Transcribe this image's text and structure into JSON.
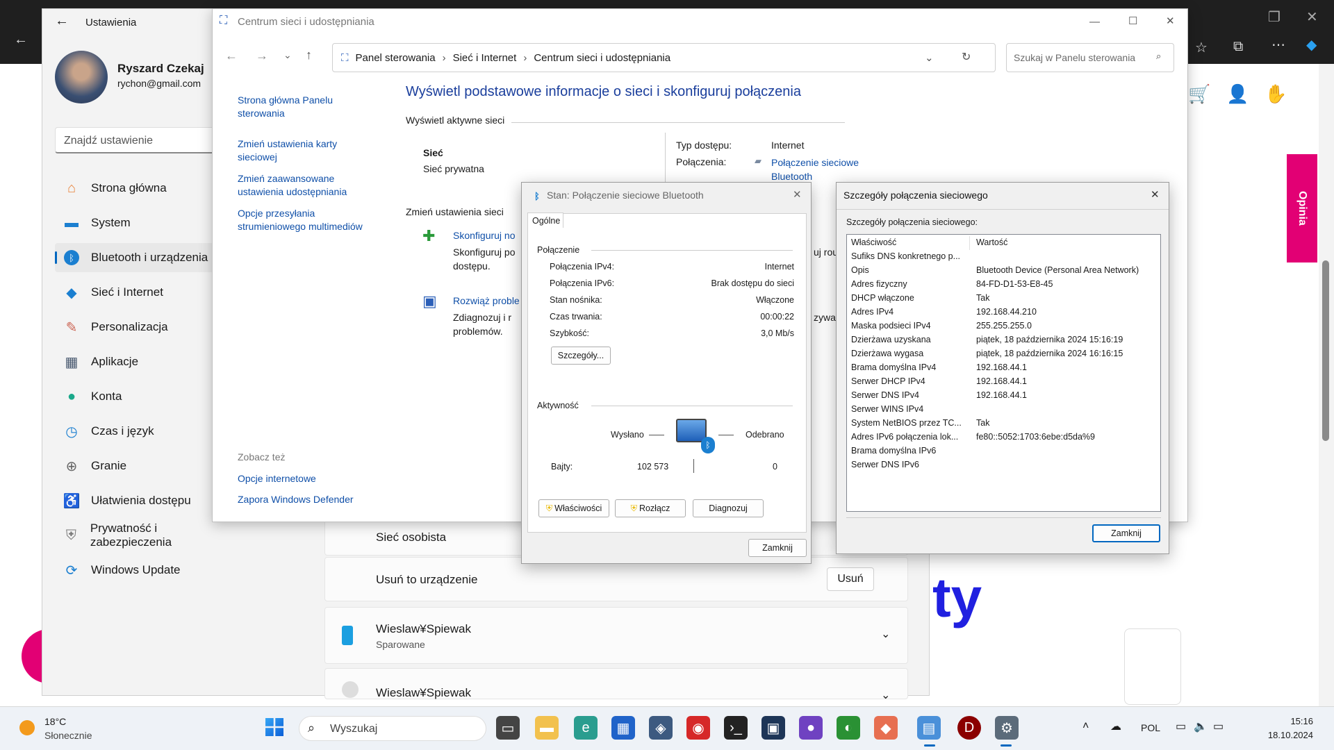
{
  "settings": {
    "title": "Ustawienia",
    "user_name": "Ryszard Czekaj",
    "user_email": "rychon@gmail.com",
    "search_placeholder": "Znajdź ustawienie",
    "nav": [
      {
        "label": "Strona główna",
        "icon": "home-icon"
      },
      {
        "label": "System",
        "icon": "monitor-icon"
      },
      {
        "label": "Bluetooth i urządzenia",
        "icon": "bluetooth-icon"
      },
      {
        "label": "Sieć i Internet",
        "icon": "wifi-icon"
      },
      {
        "label": "Personalizacja",
        "icon": "brush-icon"
      },
      {
        "label": "Aplikacje",
        "icon": "apps-icon"
      },
      {
        "label": "Konta",
        "icon": "person-icon"
      },
      {
        "label": "Czas i język",
        "icon": "clock-icon"
      },
      {
        "label": "Granie",
        "icon": "gamepad-icon"
      },
      {
        "label": "Ułatwienia dostępu",
        "icon": "accessibility-icon"
      },
      {
        "label": "Prywatność i zabezpieczenia",
        "icon": "shield-icon"
      },
      {
        "label": "Windows Update",
        "icon": "update-icon"
      }
    ],
    "personal_network": "Sieć osobista",
    "remove_device": "Usuń to urządzenie",
    "remove_button": "Usuń",
    "devices": [
      {
        "name": "Wieslaw¥Spiewak",
        "status": "Sparowane"
      },
      {
        "name": "Wieslaw¥Spiewak",
        "status": ""
      }
    ]
  },
  "background_page": {
    "opinia": "Opinia",
    "big_text": "ty"
  },
  "control_panel": {
    "title": "Centrum sieci i udostępniania",
    "breadcrumb": [
      "Panel sterowania",
      "Sieć i Internet",
      "Centrum sieci i udostępniania"
    ],
    "search_placeholder": "Szukaj w Panelu sterowania",
    "left_links": [
      "Strona główna Panelu sterowania",
      "Zmień ustawienia karty sieciowej",
      "Zmień zaawansowane ustawienia udostępniania",
      "Opcje przesyłania strumieniowego multimediów"
    ],
    "see_also": "Zobacz też",
    "see_also_links": [
      "Opcje internetowe",
      "Zapora Windows Defender"
    ],
    "heading": "Wyświetl podstawowe informacje o sieci i skonfiguruj połączenia",
    "active_networks": "Wyświetl aktywne sieci",
    "net_name": "Sieć",
    "net_type": "Sieć prywatna",
    "access_type_label": "Typ dostępu:",
    "access_type_value": "Internet",
    "connections_label": "Połączenia:",
    "connections_value_1": "Połączenie sieciowe",
    "connections_value_2": "Bluetooth",
    "change_settings": "Zmień ustawienia sieci",
    "setup_link": "Skonfiguruj no",
    "setup_desc_1": "Skonfiguruj po",
    "setup_desc_2": "dostępu.",
    "setup_tail": "uj rou",
    "troubleshoot_link": "Rozwiąż proble",
    "troubleshoot_desc_1": "Zdiagnozuj i r",
    "troubleshoot_desc_2": "problemów.",
    "troubleshoot_tail": "zywa"
  },
  "status_dialog": {
    "title": "Stan: Połączenie sieciowe Bluetooth",
    "tab": "Ogólne",
    "section_connection": "Połączenie",
    "rows": [
      {
        "label": "Połączenia IPv4:",
        "value": "Internet"
      },
      {
        "label": "Połączenia IPv6:",
        "value": "Brak dostępu do sieci"
      },
      {
        "label": "Stan nośnika:",
        "value": "Włączone"
      },
      {
        "label": "Czas trwania:",
        "value": "00:00:22"
      },
      {
        "label": "Szybkość:",
        "value": "3,0 Mb/s"
      }
    ],
    "details_button": "Szczegóły...",
    "section_activity": "Aktywność",
    "sent_label": "Wysłano",
    "received_label": "Odebrano",
    "bytes_label": "Bajty:",
    "bytes_sent": "102 573",
    "bytes_received": "0",
    "properties_button": "Właściwości",
    "disconnect_button": "Rozłącz",
    "diagnose_button": "Diagnozuj",
    "close_button": "Zamknij"
  },
  "details_dialog": {
    "title": "Szczegóły połączenia sieciowego",
    "subtitle": "Szczegóły połączenia sieciowego:",
    "col_property": "Właściwość",
    "col_value": "Wartość",
    "rows": [
      {
        "p": "Sufiks DNS konkretnego p...",
        "v": ""
      },
      {
        "p": "Opis",
        "v": "Bluetooth Device (Personal Area Network)"
      },
      {
        "p": "Adres fizyczny",
        "v": "84-FD-D1-53-E8-45"
      },
      {
        "p": "DHCP włączone",
        "v": "Tak"
      },
      {
        "p": "Adres IPv4",
        "v": "192.168.44.210"
      },
      {
        "p": "Maska podsieci IPv4",
        "v": "255.255.255.0"
      },
      {
        "p": "Dzierżawa uzyskana",
        "v": "piątek, 18 października 2024 15:16:19"
      },
      {
        "p": "Dzierżawa wygasa",
        "v": "piątek, 18 października 2024 16:16:15"
      },
      {
        "p": "Brama domyślna IPv4",
        "v": "192.168.44.1"
      },
      {
        "p": "Serwer DHCP IPv4",
        "v": "192.168.44.1"
      },
      {
        "p": "Serwer DNS IPv4",
        "v": "192.168.44.1"
      },
      {
        "p": "Serwer WINS IPv4",
        "v": ""
      },
      {
        "p": "System NetBIOS przez TC...",
        "v": "Tak"
      },
      {
        "p": "Adres IPv6 połączenia lok...",
        "v": "fe80::5052:1703:6ebe:d5da%9"
      },
      {
        "p": "Brama domyślna IPv6",
        "v": ""
      },
      {
        "p": "Serwer DNS IPv6",
        "v": ""
      }
    ],
    "close_button": "Zamknij"
  },
  "taskbar": {
    "weather_temp": "18°C",
    "weather_desc": "Słonecznie",
    "search_placeholder": "Wyszukaj",
    "language": "POL",
    "time": "15:16",
    "date": "18.10.2024"
  }
}
